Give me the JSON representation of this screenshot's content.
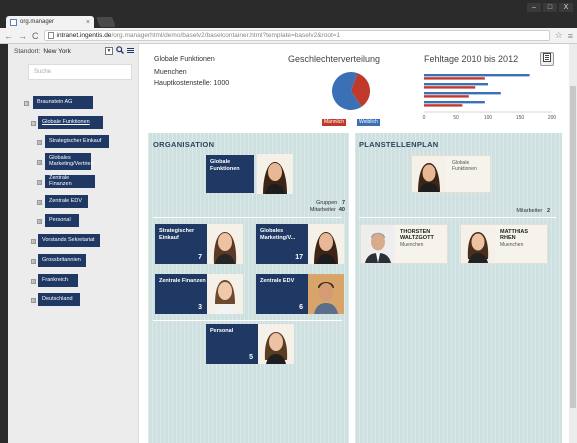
{
  "browser": {
    "tab_title": "org.manager",
    "tab_close": "×",
    "win_min": "–",
    "win_max": "□",
    "win_close": "X",
    "nav_back": "←",
    "nav_forward": "→",
    "nav_reload": "C",
    "url_host": "intranet.ingentis.de",
    "url_path": "/org.managerhtml/demo/baselv2/baselcontainer.html?template=baselv2&root=1",
    "star": "☆",
    "menu": "≡"
  },
  "sidebar": {
    "standort_label": "Standort:",
    "standort_value": "New York",
    "search_placeholder": "Suche",
    "tree": [
      {
        "label": "Braunstein AG",
        "toggle": "⊟"
      },
      {
        "label": "Globale Funktionen",
        "toggle": "⊟"
      },
      {
        "label": "Strategischer Einkauf",
        "toggle": "⊞"
      },
      {
        "label": "Globales Marketing/Vertrieb",
        "toggle": "⊞"
      },
      {
        "label": "Zentrale Finanzen",
        "toggle": "⊞"
      },
      {
        "label": "Zentrale EDV",
        "toggle": "⊞"
      },
      {
        "label": "Personal",
        "toggle": "⊞"
      },
      {
        "label": "Vorstands Sekretariat",
        "toggle": "⊞"
      },
      {
        "label": "Grossbritannien",
        "toggle": "⊞"
      },
      {
        "label": "Frankreich",
        "toggle": "⊞"
      },
      {
        "label": "Deutschland",
        "toggle": "⊞"
      }
    ]
  },
  "header": {
    "unit": "Globale Funktionen",
    "location": "Muenchen",
    "cost_center": "Hauptkostenstelle: 1000",
    "gender_title": "Geschlechterverteilung",
    "holidays_title": "Fehltage 2010 bis 2012",
    "legend_male": "Männlich",
    "legend_female": "Weiblich",
    "male_color": "#c0392b",
    "female_color": "#3b6fb6"
  },
  "chart_data": [
    {
      "type": "pie",
      "title": "Geschlechterverteilung",
      "categories": [
        "Männlich",
        "Weiblich"
      ],
      "values": [
        35,
        65
      ]
    },
    {
      "type": "bar",
      "title": "Fehltage 2010 bis 2012",
      "orientation": "horizontal",
      "categories": [
        "1",
        "2",
        "3",
        "4"
      ],
      "series": [
        {
          "values": [
            165,
            100,
            120,
            95
          ],
          "color": "#3b6fb6"
        },
        {
          "values": [
            95,
            80,
            70,
            60
          ],
          "color": "#c0392b"
        }
      ],
      "xticks": [
        "0",
        "50",
        "100",
        "150",
        "200"
      ],
      "xlim": [
        0,
        200
      ]
    }
  ],
  "organisation": {
    "title": "ORGANISATION",
    "root": {
      "name": "Globale Funktionen"
    },
    "stats": {
      "groups_label": "Gruppen",
      "groups_value": "7",
      "staff_label": "Mitarbeiter",
      "staff_value": "40"
    },
    "units": [
      {
        "name": "Strategischer Einkauf",
        "count": "7"
      },
      {
        "name": "Globales Marketing/V...",
        "count": "17"
      },
      {
        "name": "Zentrale Finanzen",
        "count": "3"
      },
      {
        "name": "Zentrale EDV",
        "count": "6"
      },
      {
        "name": "Personal",
        "count": "5"
      }
    ]
  },
  "planstellen": {
    "title": "PLANSTELLENPLAN",
    "root": {
      "line1": "Globale",
      "line2": "Funktionen"
    },
    "staff_label": "Mitarbeiter",
    "staff_value": "2",
    "people": [
      {
        "first": "THORSTEN",
        "last": "WALTZGOTT",
        "location": "Muenchen"
      },
      {
        "first": "MATTHIAS",
        "last": "RHEN",
        "location": "Muenchen"
      }
    ]
  }
}
